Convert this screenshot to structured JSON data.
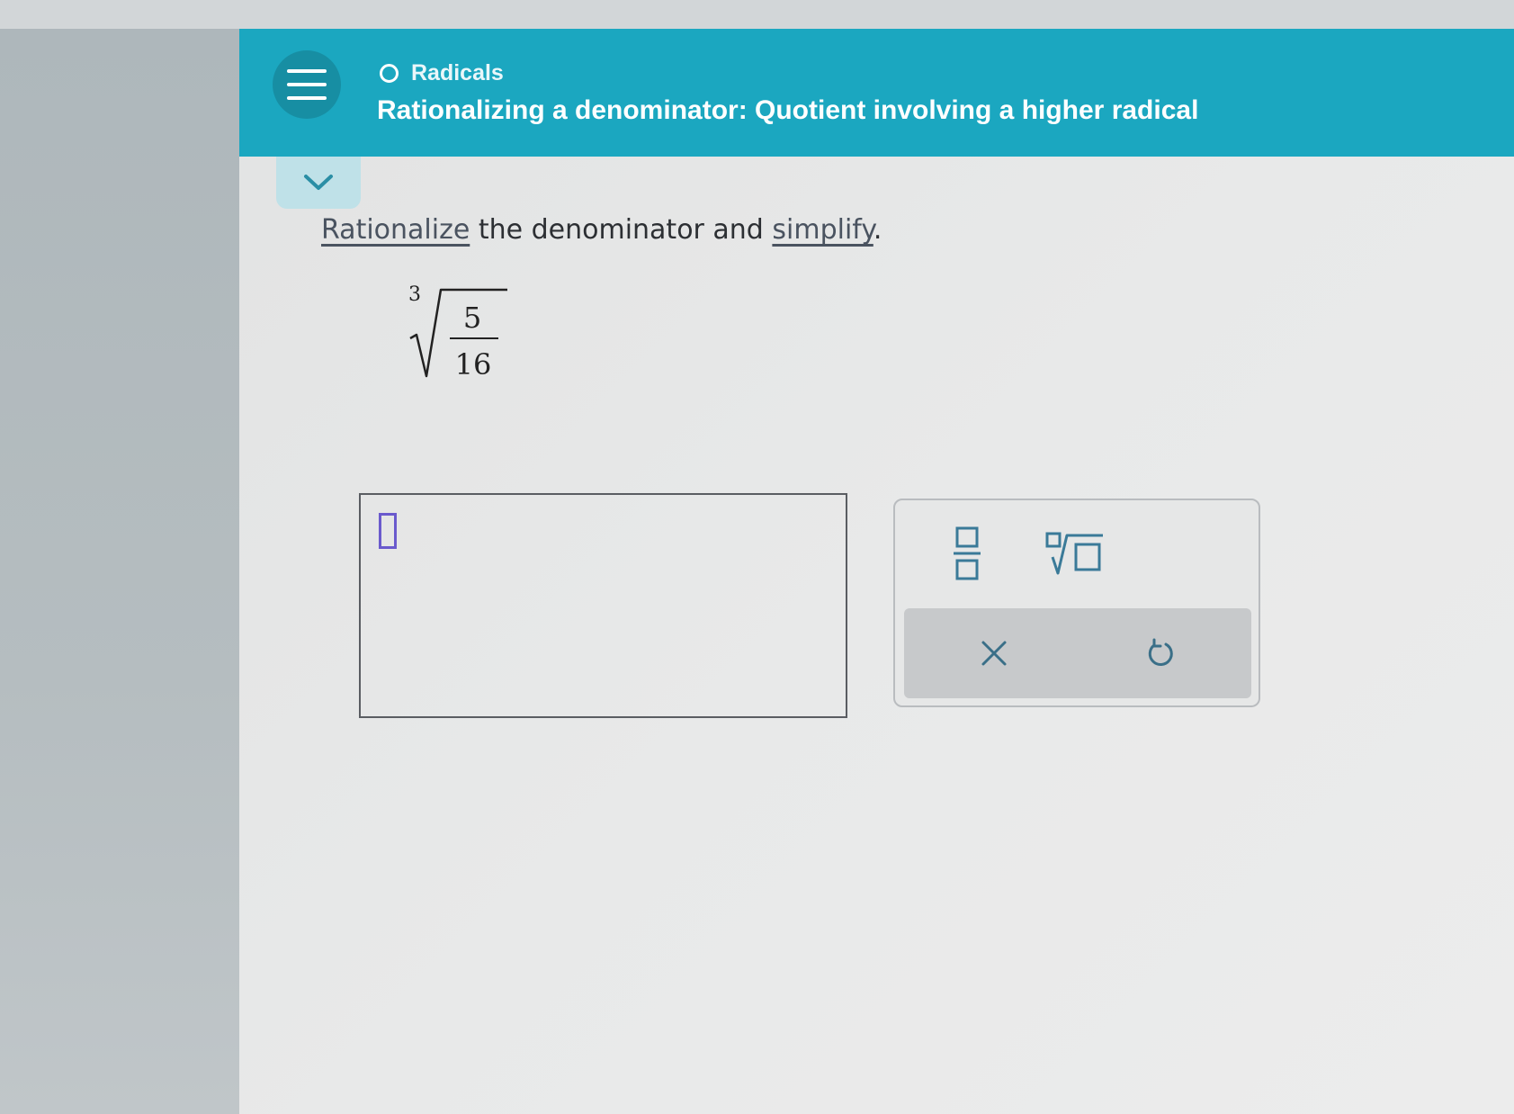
{
  "header": {
    "breadcrumb": "Radicals",
    "title": "Rationalizing a denominator: Quotient involving a higher radical"
  },
  "problem": {
    "prompt_link_1": "Rationalize",
    "prompt_mid": " the denominator and ",
    "prompt_link_2": "simplify",
    "prompt_end": ".",
    "expression": {
      "root_index": "3",
      "numerator": "5",
      "denominator": "16"
    }
  },
  "answer": {
    "value": ""
  },
  "keypad": {
    "keys": [
      "fraction-key",
      "nth-root-key"
    ],
    "actions": [
      "clear",
      "undo"
    ]
  },
  "colors": {
    "header_bg": "#1ba7c0",
    "menu_btn_bg": "#178ea3",
    "collapse_tab_bg": "#bfe1e8",
    "cursor_box": "#6a5acd",
    "icon_blue": "#3a7a98"
  }
}
